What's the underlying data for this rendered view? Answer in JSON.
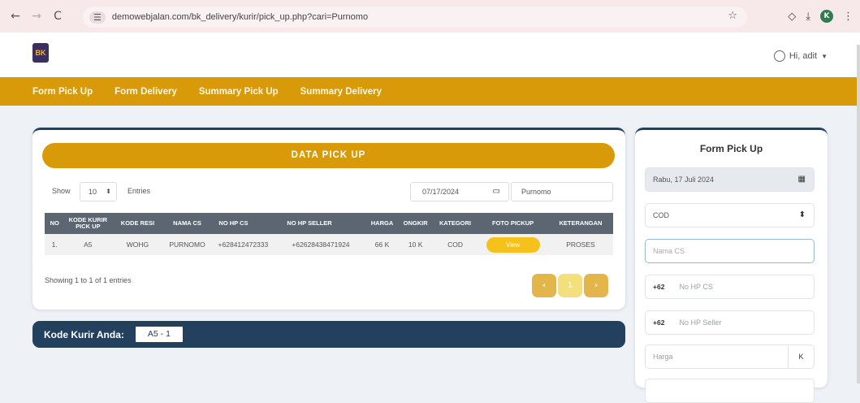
{
  "browser": {
    "url": "demowebjalan.com/bk_delivery/kurir/pick_up.php?cari=Purnomo",
    "icons": [
      "back-arrow-icon",
      "forward-arrow-icon",
      "reload-icon",
      "tune-icon",
      "star-icon",
      "extensions-icon",
      "download-icon",
      "kebab-menu-icon"
    ],
    "profile_initial": "K"
  },
  "header": {
    "logo_text": "BK",
    "greeting": "Hi, adit"
  },
  "nav": {
    "items": [
      "Form Pick Up",
      "Form Delivery",
      "Summary Pick Up",
      "Summary Delivery"
    ]
  },
  "table_card": {
    "title": "DATA PICK UP",
    "show_label": "Show",
    "length_value": "10",
    "entries_label": "Entries",
    "date_value": "07/17/2024",
    "search_value": "Purnomo",
    "columns": [
      "NO",
      "KODE KURIR PICK UP",
      "KODE RESI",
      "NAMA CS",
      "NO HP CS",
      "NO HP SELLER",
      "HARGA",
      "ONGKIR",
      "KATEGORI",
      "FOTO PICKUP",
      "KETERANGAN"
    ],
    "rows": [
      {
        "no": "1.",
        "kode_kurir": "A5",
        "kode_resi": "WOHG",
        "nama_cs": "PURNOMO",
        "no_hp_cs": "+628412472333",
        "no_hp_seller": "+62628438471924",
        "harga": "66 K",
        "ongkir": "10 K",
        "kategori": "COD",
        "foto_label": "View",
        "keterangan": "PROSES"
      }
    ],
    "showing_text": "Showing 1 to 1 of 1 entries",
    "pager": {
      "prev": "‹",
      "current": "1",
      "next": "›"
    }
  },
  "kurir": {
    "label": "Kode Kurir Anda:",
    "value": "A5 - 1"
  },
  "form": {
    "title": "Form Pick Up",
    "date_value": "Rabu, 17 Juli 2024",
    "category_value": "COD",
    "nama_cs_placeholder": "Nama CS",
    "phone_prefix": "+62",
    "no_hp_cs_placeholder": "No HP CS",
    "no_hp_seller_placeholder": "No HP Seller",
    "harga_placeholder": "Harga",
    "harga_suffix": "K"
  },
  "colors": {
    "accent_orange": "#d99a0a",
    "navy": "#23405f",
    "table_header": "#5b6672",
    "view_button": "#f5c11a"
  }
}
